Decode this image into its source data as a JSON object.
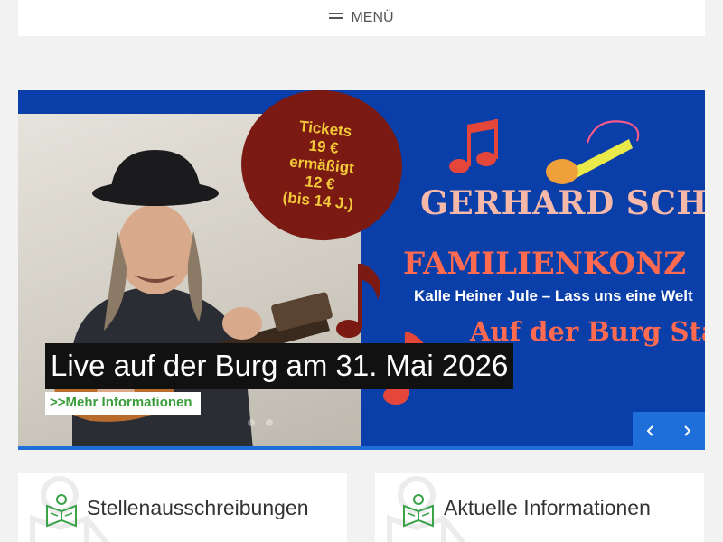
{
  "header": {
    "menu_label": "MENÜ"
  },
  "slider": {
    "poster": {
      "tickets_lines": [
        "Tickets",
        "19 €",
        "ermäßigt",
        "12 €",
        "(bis 14 J.)"
      ],
      "headline": "GERHARD SCHÖ",
      "subtitle": "FAMILIENKONZ",
      "tagline": "Kalle Heiner Jule – Lass uns eine Welt",
      "venue": "Auf der Burg Starga"
    },
    "caption": "Live auf der Burg am 31. Mai 2026",
    "more_link": ">>Mehr Informationen",
    "prev_icon": "chevron-left-icon",
    "next_icon": "chevron-right-icon",
    "dots": 2
  },
  "cards": [
    {
      "title": "Stellenausschreibungen",
      "icon": "reader-book-icon"
    },
    {
      "title": "Aktuelle Informationen",
      "icon": "reader-book-icon"
    }
  ],
  "colors": {
    "slider_bg": "#0a3ea8",
    "accent_blue": "#1e6fd9",
    "link_green": "#3a9c3a",
    "poster_red": "#ff6a50",
    "tickets_bg": "#7a1a12",
    "tickets_text": "#f4c93a"
  }
}
